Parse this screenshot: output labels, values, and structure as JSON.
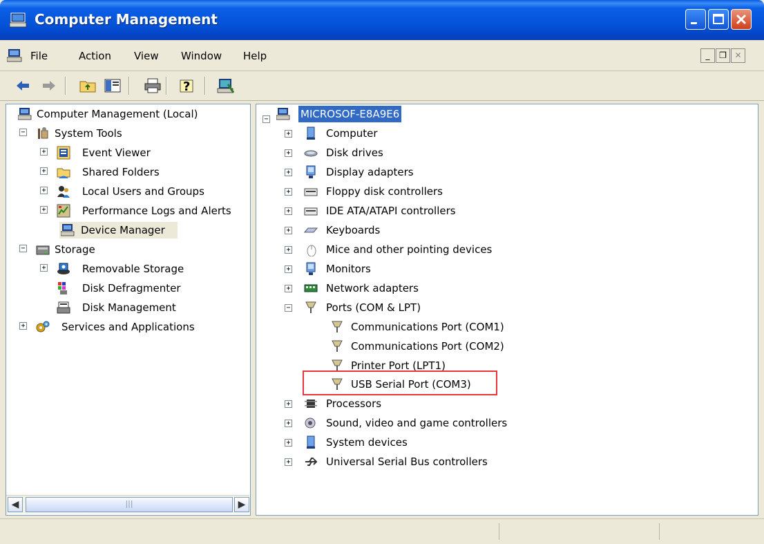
{
  "window": {
    "title": "Computer Management",
    "title_icon": "computer-management-icon",
    "controls": [
      "minimize",
      "maximize",
      "close"
    ]
  },
  "menu": {
    "items": [
      "File",
      "Action",
      "View",
      "Window",
      "Help"
    ]
  },
  "toolbar": {
    "buttons": [
      "back-icon",
      "forward-icon",
      "up-folder-icon",
      "show-hide-tree-icon",
      "print-icon",
      "help-icon",
      "properties-icon"
    ]
  },
  "left_tree": {
    "root": "Computer Management (Local)",
    "system_tools": "System Tools",
    "event_viewer": "Event Viewer",
    "shared_folders": "Shared Folders",
    "local_users": "Local Users and Groups",
    "perf_logs": "Performance Logs and Alerts",
    "device_manager": "Device Manager",
    "storage": "Storage",
    "removable_storage": "Removable Storage",
    "disk_defrag": "Disk Defragmenter",
    "disk_management": "Disk Management",
    "services_apps": "Services and Applications"
  },
  "right_tree": {
    "root": "MICROSOF-E8A9E6",
    "computer": "Computer",
    "disk_drives": "Disk drives",
    "display_adapters": "Display adapters",
    "floppy": "Floppy disk controllers",
    "ide": "IDE ATA/ATAPI controllers",
    "keyboards": "Keyboards",
    "mice": "Mice and other pointing devices",
    "monitors": "Monitors",
    "network": "Network adapters",
    "ports": "Ports (COM & LPT)",
    "com1": "Communications Port (COM1)",
    "com2": "Communications Port (COM2)",
    "lpt1": "Printer Port (LPT1)",
    "usb_serial": "USB Serial Port (COM3)",
    "processors": "Processors",
    "sound": "Sound, video and game controllers",
    "system_devices": "System devices",
    "usb_controllers": "Universal Serial Bus controllers"
  },
  "colors": {
    "selection": "#316AC5",
    "highlight_box": "#E8343A",
    "titlebar": "#0553D8"
  }
}
